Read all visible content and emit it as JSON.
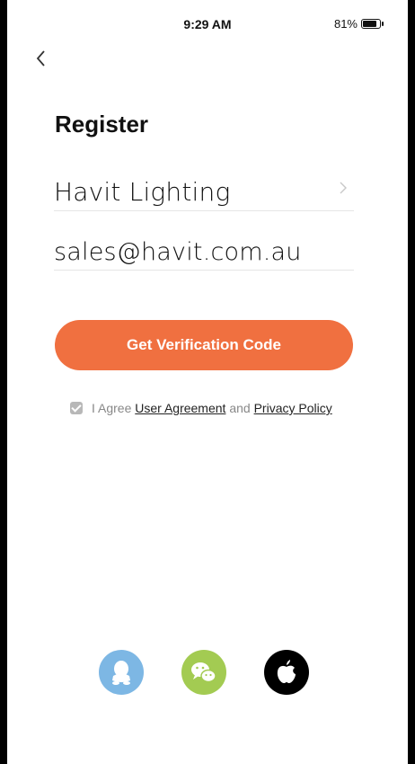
{
  "status_bar": {
    "time": "9:29 AM",
    "battery": "81%"
  },
  "page": {
    "title": "Register"
  },
  "form": {
    "region_value": "Havit Lighting",
    "email_value": "sales@havit.com.au",
    "submit_label": "Get Verification Code"
  },
  "agreement": {
    "prefix": "I Agree",
    "user_agreement": "User Agreement",
    "conjunction": "and",
    "privacy_policy": "Privacy Policy",
    "checked": true
  },
  "social_login": [
    {
      "icon": "qq-icon",
      "color": "#7db7e4"
    },
    {
      "icon": "wechat-icon",
      "color": "#a3cb52"
    },
    {
      "icon": "apple-icon",
      "color": "#000000"
    }
  ],
  "colors": {
    "accent": "#f07040"
  }
}
